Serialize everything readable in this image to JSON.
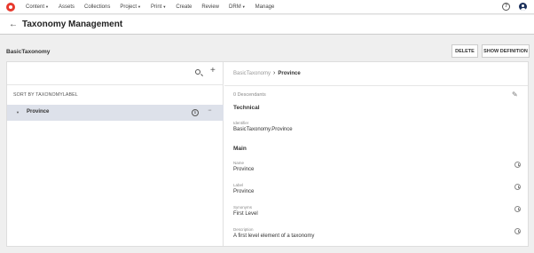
{
  "nav": {
    "items": [
      {
        "label": "Content",
        "dropdown": true
      },
      {
        "label": "Assets",
        "dropdown": false
      },
      {
        "label": "Collections",
        "dropdown": false
      },
      {
        "label": "Project",
        "dropdown": true
      },
      {
        "label": "Print",
        "dropdown": true
      },
      {
        "label": "Create",
        "dropdown": false
      },
      {
        "label": "Review",
        "dropdown": false
      },
      {
        "label": "DRM",
        "dropdown": true
      },
      {
        "label": "Manage",
        "dropdown": false
      }
    ],
    "help_glyph": "?"
  },
  "header": {
    "title": "Taxonomy Management",
    "back_glyph": "←"
  },
  "taxonomy": {
    "name": "BasicTaxonomy",
    "delete_label": "DELETE",
    "show_definition_label": "SHOW DEFINITION"
  },
  "left_panel": {
    "sort_label": "SORT BY TAXONOMYLABEL",
    "add_glyph": "+",
    "tree": [
      {
        "label": "Province",
        "expanded": false
      }
    ],
    "info_glyph": "i",
    "more_glyph": "···"
  },
  "right_panel": {
    "breadcrumb": {
      "root": "BasicTaxonomy",
      "separator": "›",
      "current": "Province"
    },
    "descendants": "0 Descendants",
    "technical": {
      "title": "Technical",
      "identifier_label": "Identifier",
      "identifier_value": "BasicTaxonomy.Province"
    },
    "main": {
      "title": "Main",
      "fields": [
        {
          "label": "Name",
          "value": "Province"
        },
        {
          "label": "Label",
          "value": "Province"
        },
        {
          "label": "Synonyms",
          "value": "First Level"
        },
        {
          "label": "Description",
          "value": "A first level element of a taxonomy"
        }
      ]
    }
  },
  "colors": {
    "brand": "#e8392d",
    "selected_row": "#dde1ea",
    "user_avatar": "#1a2f5a"
  },
  "icons": [
    "logo-icon",
    "help-icon",
    "user-icon",
    "back-icon",
    "search-icon",
    "plus-icon",
    "caret-icon",
    "info-icon",
    "more-icon",
    "edit-icon",
    "history-icon"
  ]
}
